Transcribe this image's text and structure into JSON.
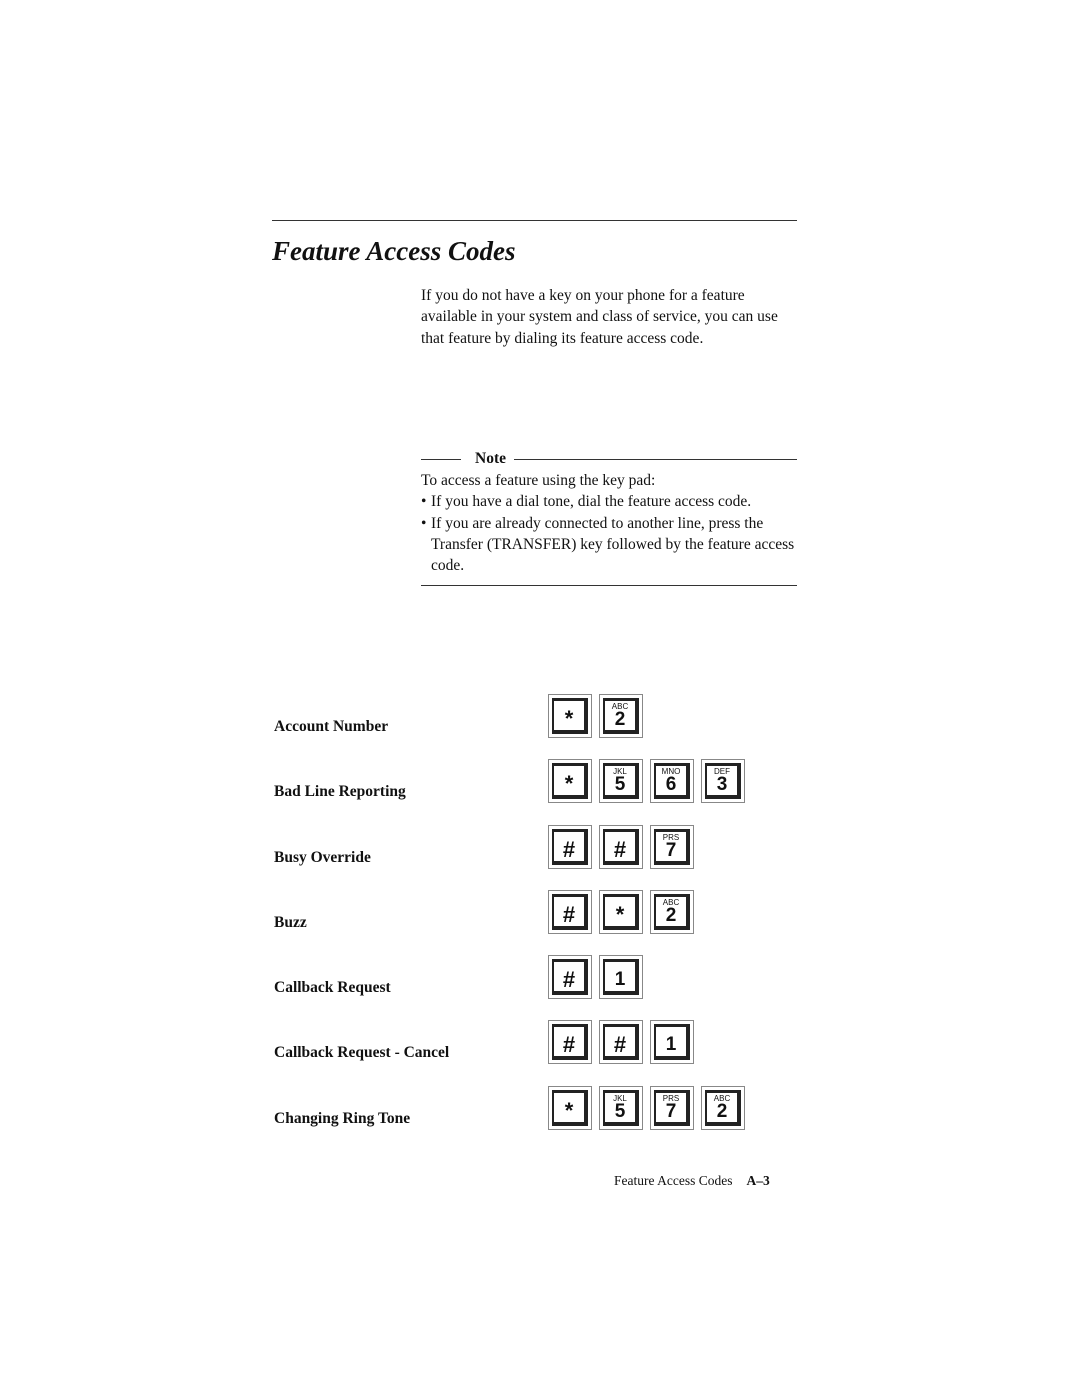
{
  "page": {
    "title": "Feature Access Codes",
    "intro": "If you do not have a key on your phone for a feature available in your system and class of service, you can use that feature by dialing its feature access code."
  },
  "note": {
    "label": "Note",
    "lead": "To access a feature using the key pad:",
    "items": [
      "If you have a dial tone, dial the feature access code.",
      "If you are already connected to another line, press the Transfer (TRANSFER) key followed by the feature access code."
    ]
  },
  "codes": [
    {
      "label": "Account Number",
      "keys": [
        {
          "main": "*",
          "letters": ""
        },
        {
          "main": "2",
          "letters": "ABC"
        }
      ]
    },
    {
      "label": "Bad Line Reporting",
      "keys": [
        {
          "main": "*",
          "letters": ""
        },
        {
          "main": "5",
          "letters": "JKL"
        },
        {
          "main": "6",
          "letters": "MNO"
        },
        {
          "main": "3",
          "letters": "DEF"
        }
      ]
    },
    {
      "label": "Busy Override",
      "keys": [
        {
          "main": "#",
          "letters": ""
        },
        {
          "main": "#",
          "letters": ""
        },
        {
          "main": "7",
          "letters": "PRS"
        }
      ]
    },
    {
      "label": "Buzz",
      "keys": [
        {
          "main": "#",
          "letters": ""
        },
        {
          "main": "*",
          "letters": ""
        },
        {
          "main": "2",
          "letters": "ABC"
        }
      ]
    },
    {
      "label": "Callback Request",
      "keys": [
        {
          "main": "#",
          "letters": ""
        },
        {
          "main": "1",
          "letters": ""
        }
      ]
    },
    {
      "label": "Callback Request - Cancel",
      "keys": [
        {
          "main": "#",
          "letters": ""
        },
        {
          "main": "#",
          "letters": ""
        },
        {
          "main": "1",
          "letters": ""
        }
      ]
    },
    {
      "label": "Changing Ring Tone",
      "keys": [
        {
          "main": "*",
          "letters": ""
        },
        {
          "main": "5",
          "letters": "JKL"
        },
        {
          "main": "7",
          "letters": "PRS"
        },
        {
          "main": "2",
          "letters": "ABC"
        }
      ]
    }
  ],
  "footer": {
    "section": "Feature Access Codes",
    "page_number": "A–3"
  }
}
